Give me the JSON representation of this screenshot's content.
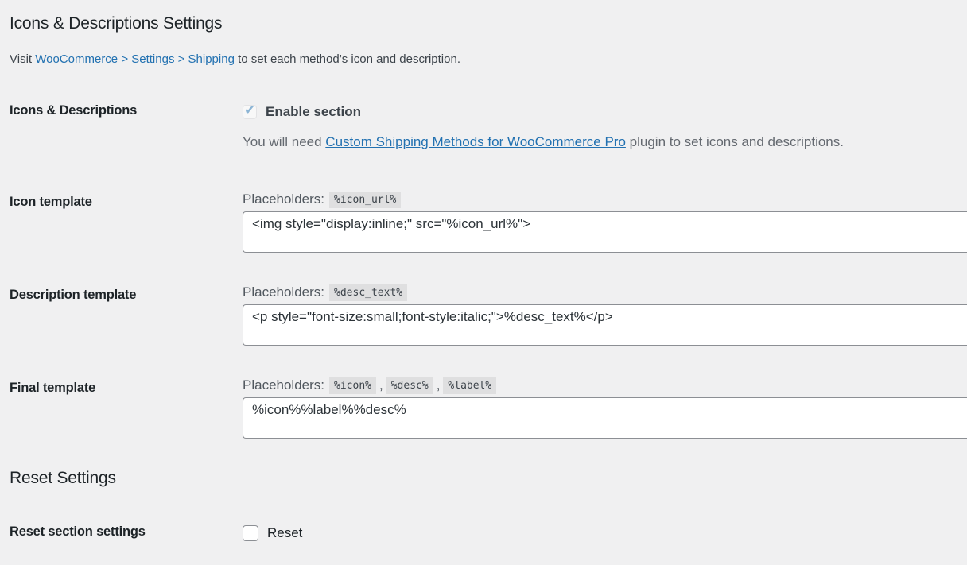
{
  "sections": {
    "icons": {
      "title": "Icons & Descriptions Settings",
      "intro_prefix": "Visit ",
      "intro_link": "WooCommerce > Settings > Shipping",
      "intro_suffix": " to set each method’s icon and description."
    },
    "reset": {
      "title": "Reset Settings"
    }
  },
  "rows": {
    "enable": {
      "label": "Icons & Descriptions",
      "checkbox_label": "Enable section",
      "checked": true,
      "disabled": true,
      "desc_prefix": "You will need ",
      "desc_link": "Custom Shipping Methods for WooCommerce Pro",
      "desc_suffix": " plugin to set icons and descriptions."
    },
    "icon_template": {
      "label": "Icon template",
      "placeholders_label": "Placeholders:",
      "placeholders": [
        "%icon_url%"
      ],
      "value": "<img style=\"display:inline;\" src=\"%icon_url%\">"
    },
    "desc_template": {
      "label": "Description template",
      "placeholders_label": "Placeholders:",
      "placeholders": [
        "%desc_text%"
      ],
      "value": "<p style=\"font-size:small;font-style:italic;\">%desc_text%</p>"
    },
    "final_template": {
      "label": "Final template",
      "placeholders_label": "Placeholders:",
      "placeholders": [
        "%icon%",
        "%desc%",
        "%label%"
      ],
      "separator": ",",
      "value": "%icon%%label%%desc%"
    },
    "reset": {
      "label": "Reset section settings",
      "checkbox_label": "Reset",
      "checked": false
    }
  },
  "colors": {
    "background": "#f0f0f1",
    "link": "#2271b1",
    "text": "#1d2327",
    "muted": "#646970"
  }
}
